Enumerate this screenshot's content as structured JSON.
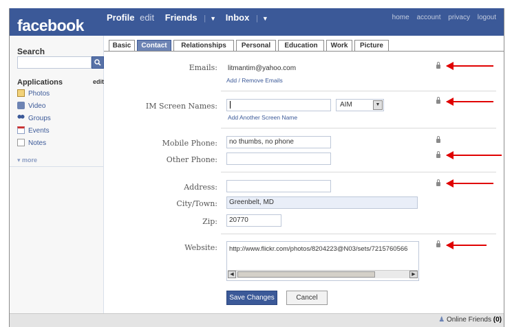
{
  "brand": {
    "logo_text": "facebook",
    "color": "#3b5998"
  },
  "nav": {
    "profile": "Profile",
    "profile_edit": "edit",
    "friends": "Friends",
    "inbox": "Inbox",
    "right": [
      "home",
      "account",
      "privacy",
      "logout"
    ]
  },
  "sidebar": {
    "search_label": "Search",
    "search_button_icon": "search-icon",
    "applications_label": "Applications",
    "applications_edit": "edit",
    "apps": [
      {
        "label": "Photos",
        "icon": "photos-icon"
      },
      {
        "label": "Video",
        "icon": "video-icon"
      },
      {
        "label": "Groups",
        "icon": "groups-icon"
      },
      {
        "label": "Events",
        "icon": "events-icon"
      },
      {
        "label": "Notes",
        "icon": "notes-icon"
      }
    ],
    "more": "more"
  },
  "tabs": [
    "Basic",
    "Contact",
    "Relationships",
    "Personal",
    "Education",
    "Work",
    "Picture"
  ],
  "active_tab": "Contact",
  "contact": {
    "emails_label": "Emails:",
    "email_value": "litmantim@yahoo.com",
    "add_remove_emails": "Add / Remove Emails",
    "im_label": "IM Screen Names:",
    "im_value": "",
    "im_service": "AIM",
    "add_screen_name": "Add Another Screen Name",
    "mobile_label": "Mobile Phone:",
    "mobile_value": "no thumbs, no phone",
    "other_label": "Other Phone:",
    "other_value": "",
    "address_label": "Address:",
    "address_value": "",
    "city_label": "City/Town:",
    "city_value": "Greenbelt, MD",
    "zip_label": "Zip:",
    "zip_value": "20770",
    "website_label": "Website:",
    "website_value": "http://www.flickr.com/photos/8204223@N03/sets/7215760566"
  },
  "buttons": {
    "save": "Save Changes",
    "cancel": "Cancel"
  },
  "footer": {
    "online_label": "Online Friends",
    "online_count": "(0)"
  },
  "annotation_color": "#e00000"
}
